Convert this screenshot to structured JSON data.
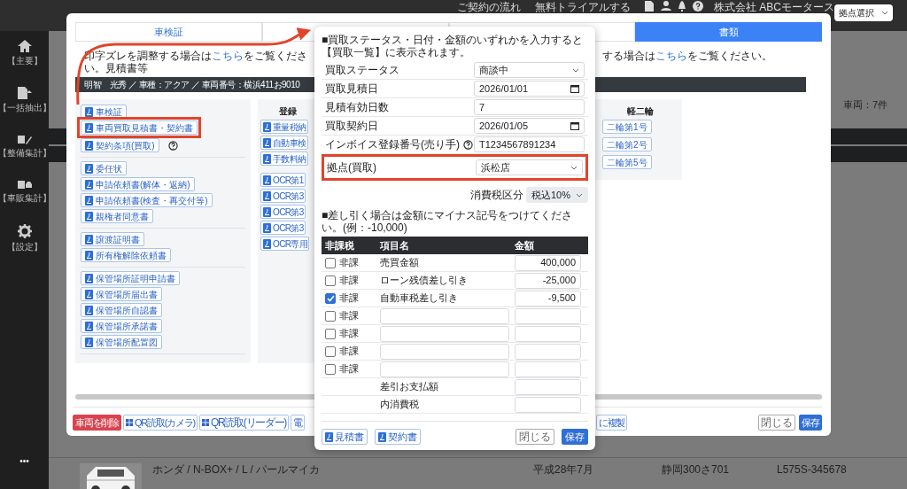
{
  "top_bar": {
    "links": [
      "ご契約の流れ",
      "無料トライアルする"
    ],
    "company": "株式会社 ABCモータース",
    "branch_select": "拠点選択"
  },
  "sidebar": {
    "items": [
      {
        "label": "【主要】"
      },
      {
        "label": "【一括抽出】"
      },
      {
        "label": "【整備集計】"
      },
      {
        "label": "【車販集計】"
      },
      {
        "label": "【設定】"
      }
    ],
    "more": "•••"
  },
  "background": {
    "count": "車両：7件",
    "row": {
      "car": "ホンダ / N-BOX+ / L / パールマイカ",
      "first_registration": "平成28年7月",
      "plate": "静岡300さ701",
      "chassis": "L575S-345678"
    }
  },
  "vehicle_modal": {
    "tabs": [
      {
        "label": "車検証",
        "selected": false
      },
      {
        "selected": false
      },
      {
        "selected": false
      },
      {
        "label": "書類",
        "selected": true
      }
    ],
    "notice_left": {
      "before": "印字ズレを調整する場合は",
      "link": "こちら",
      "after": "をご覧ください。見積書等"
    },
    "notice_right": {
      "before": "する場合は",
      "link": "こちら",
      "after": "をご覧ください。"
    },
    "owner_bar": "明智　光秀 ／ 車種：アクア ／ 車両番号：横浜411お9010",
    "doc_groups": [
      [
        {
          "label": "車検証",
          "highlighted": false,
          "help": false
        },
        {
          "label": "車両買取見積書・契約書",
          "highlighted": true,
          "help": false
        },
        {
          "label": "契約条項(買取)",
          "highlighted": false,
          "help": true
        }
      ],
      [
        {
          "label": "委任状",
          "highlighted": false,
          "help": false
        },
        {
          "label": "申請依頼書(解体・返納)",
          "highlighted": false,
          "help": false
        },
        {
          "label": "申請依頼書(検査・再交付等)",
          "highlighted": false,
          "help": false
        },
        {
          "label": "親権者同意書",
          "highlighted": false,
          "help": false
        }
      ],
      [
        {
          "label": "譲渡証明書",
          "highlighted": false,
          "help": false
        },
        {
          "label": "所有権解除依頼書",
          "highlighted": false,
          "help": false
        }
      ],
      [
        {
          "label": "保管場所証明申請書",
          "highlighted": false,
          "help": false
        },
        {
          "label": "保管場所届出書",
          "highlighted": false,
          "help": false
        },
        {
          "label": "保管場所自認書",
          "highlighted": false,
          "help": false
        },
        {
          "label": "保管場所承諾書",
          "highlighted": false,
          "help": false
        },
        {
          "label": "保管場所配置図",
          "highlighted": false,
          "help": false
        }
      ]
    ],
    "registered_panel": {
      "heading": "登録",
      "groups": [
        [
          "重量税納",
          "自動車検",
          "手数料納"
        ],
        [
          "OCR第1",
          "OCR第3",
          "OCR第3",
          "OCR第3",
          "OCR専用"
        ]
      ]
    },
    "kei_panel": {
      "heading": "軽二輪",
      "buttons": [
        "二輪第1号",
        "二輪第2号",
        "二輪第5号"
      ]
    },
    "footer_left": [
      {
        "label": "車両を削除",
        "kind": "danger"
      },
      {
        "label": "QR読取(カメラ)",
        "kind": "qr"
      },
      {
        "label": "QR読取(リーダー)",
        "kind": "qr"
      },
      {
        "label": "電",
        "kind": "plain"
      }
    ],
    "footer_mid": "に複製",
    "footer_right": [
      {
        "label": "閉じる",
        "kind": "close"
      },
      {
        "label": "保存",
        "kind": "save"
      }
    ]
  },
  "purchase_modal": {
    "note": "■買取ステータス・日付・金額のいずれかを入力すると【買取一覧】に表示されます。",
    "fields": [
      {
        "label": "買取ステータス",
        "kind": "select",
        "value": "商談中",
        "help": false,
        "highlighted": false
      },
      {
        "label": "買取見積日",
        "kind": "date",
        "value": "2026/01/01",
        "help": false,
        "highlighted": false
      },
      {
        "label": "見積有効日数",
        "kind": "text",
        "value": "7",
        "help": false,
        "highlighted": false
      },
      {
        "label": "買取契約日",
        "kind": "date",
        "value": "2026/01/05",
        "help": false,
        "highlighted": false
      },
      {
        "label": "インボイス登録番号(売り手)",
        "kind": "text",
        "value": "T1234567891234",
        "help": true,
        "highlighted": false
      },
      {
        "label": "拠点(買取)",
        "kind": "select",
        "value": "浜松店",
        "help": false,
        "highlighted": true
      }
    ],
    "tax": {
      "label": "消費税区分",
      "value": "税込10%"
    },
    "note2": "■差し引く場合は金額にマイナス記号をつけてください。(例：-10,000)",
    "columns": [
      "非課税",
      "項目名",
      "金額"
    ],
    "rows": [
      {
        "kind": "entry",
        "checked": false,
        "tax_label": "非課",
        "name": "売買金額",
        "amount": "400,000"
      },
      {
        "kind": "entry",
        "checked": false,
        "tax_label": "非課",
        "name": "ローン残債差し引き",
        "amount": "-25,000"
      },
      {
        "kind": "entry",
        "checked": true,
        "tax_label": "非課",
        "name": "自動車税差し引き",
        "amount": "-9,500"
      },
      {
        "kind": "blank",
        "checked": false,
        "tax_label": "非課"
      },
      {
        "kind": "blank",
        "checked": false,
        "tax_label": "非課"
      },
      {
        "kind": "blank",
        "checked": false,
        "tax_label": "非課"
      },
      {
        "kind": "blank",
        "checked": false,
        "tax_label": "非課"
      }
    ],
    "totals": [
      {
        "label": "差引お支払額"
      },
      {
        "label": "内消費税"
      }
    ],
    "buttons_left": [
      "見積書",
      "契約書"
    ],
    "buttons_right": [
      {
        "label": "閉じる",
        "kind": "close"
      },
      {
        "label": "保存",
        "kind": "save"
      }
    ]
  }
}
